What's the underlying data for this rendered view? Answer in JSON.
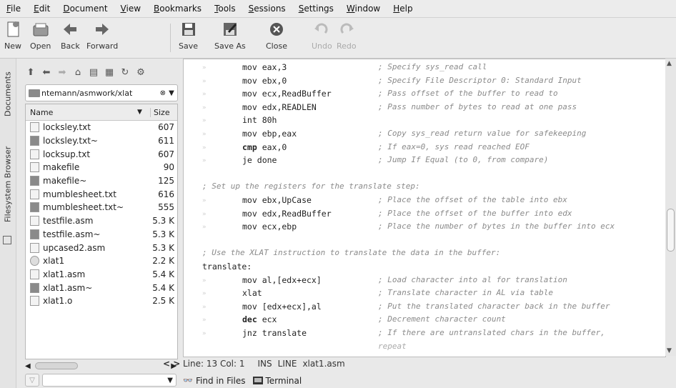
{
  "menubar": [
    "File",
    "Edit",
    "Document",
    "View",
    "Bookmarks",
    "Tools",
    "Sessions",
    "Settings",
    "Window",
    "Help"
  ],
  "toolbar": {
    "new": "New",
    "open": "Open",
    "back": "Back",
    "forward": "Forward",
    "save": "Save",
    "save_as": "Save As",
    "close": "Close",
    "undo": "Undo",
    "redo": "Redo"
  },
  "vtabs": {
    "documents": "Documents",
    "filesystem": "Filesystem Browser"
  },
  "sidebar": {
    "path": "ntemann/asmwork/xlat",
    "columns": {
      "name": "Name",
      "size": "Size"
    },
    "files": [
      {
        "name": "locksley.txt",
        "size": "607",
        "kind": "text"
      },
      {
        "name": "locksley.txt~",
        "size": "611",
        "kind": "backup"
      },
      {
        "name": "locksup.txt",
        "size": "607",
        "kind": "text"
      },
      {
        "name": "makefile",
        "size": "90",
        "kind": "make"
      },
      {
        "name": "makefile~",
        "size": "125",
        "kind": "backup"
      },
      {
        "name": "mumblesheet.txt",
        "size": "616",
        "kind": "text"
      },
      {
        "name": "mumblesheet.txt~",
        "size": "555",
        "kind": "backup"
      },
      {
        "name": "testfile.asm",
        "size": "5.3 K",
        "kind": "text"
      },
      {
        "name": "testfile.asm~",
        "size": "5.3 K",
        "kind": "backup"
      },
      {
        "name": "upcased2.asm",
        "size": "5.3 K",
        "kind": "text"
      },
      {
        "name": "xlat1",
        "size": "2.2 K",
        "kind": "exe"
      },
      {
        "name": "xlat1.asm",
        "size": "5.4 K",
        "kind": "text"
      },
      {
        "name": "xlat1.asm~",
        "size": "5.4 K",
        "kind": "backup"
      },
      {
        "name": "xlat1.o",
        "size": "2.5 K",
        "kind": "object"
      }
    ]
  },
  "code": [
    {
      "i": "mov eax,3",
      "c": "; Specify sys_read call"
    },
    {
      "i": "mov ebx,0",
      "c": "; Specify File Descriptor 0: Standard Input"
    },
    {
      "i": "mov ecx,ReadBuffer",
      "c": "; Pass offset of the buffer to read to"
    },
    {
      "i": "mov edx,READLEN",
      "c": "; Pass number of bytes to read at one pass"
    },
    {
      "i": "int 80h",
      "c": ""
    },
    {
      "i": "mov ebp,eax",
      "c": "; Copy sys_read return value for safekeeping"
    },
    {
      "kw": "cmp",
      "i": " eax,0",
      "c": "; If eax=0, sys read reached EOF"
    },
    {
      "i": "je done",
      "c": "; Jump If Equal (to 0, from compare)"
    },
    {
      "blank": true
    },
    {
      "full": "; Set up the registers for the translate step:"
    },
    {
      "i": "mov ebx,UpCase",
      "c": "; Place the offset of the table into ebx"
    },
    {
      "i": "mov edx,ReadBuffer",
      "c": "; Place the offset of the buffer into edx"
    },
    {
      "i": "mov ecx,ebp",
      "c": "; Place the number of bytes in the buffer into ecx"
    },
    {
      "blank": true
    },
    {
      "full": "; Use the XLAT instruction to translate the data in the buffer:"
    },
    {
      "label": "translate:"
    },
    {
      "i": "mov al,[edx+ecx]",
      "c": "; Load character into al for translation"
    },
    {
      "i": "xlat",
      "c": "; Translate character in AL via table"
    },
    {
      "i": "mov [edx+ecx],al",
      "c": "; Put the translated character back in the buffer"
    },
    {
      "kw": "dec",
      "i": " ecx",
      "c": "; Decrement character count"
    },
    {
      "i": "jnz translate",
      "c": "; If there are untranslated chars in the buffer,"
    },
    {
      "cont": "repeat"
    }
  ],
  "status": {
    "position": "Line: 13 Col: 1",
    "mode": "INS",
    "sel": "LINE",
    "file": "xlat1.asm",
    "nav": "< >"
  },
  "bottom_tabs": {
    "find": "Find in Files",
    "terminal": "Terminal"
  }
}
